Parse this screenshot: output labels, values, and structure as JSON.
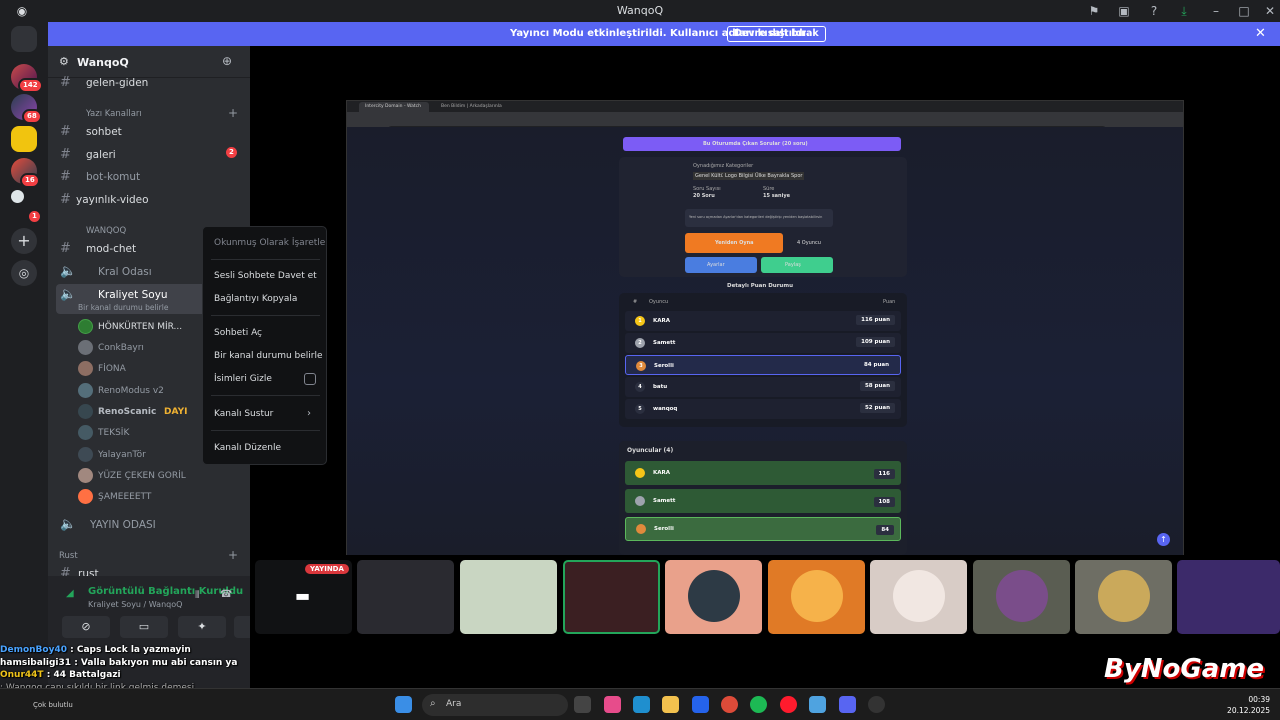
{
  "window": {
    "title": "WanqoQ"
  },
  "banner": {
    "message": "Yayıncı Modu etkinleştirildi. Kullanıcı adları kısaltıldı.",
    "button": "Devre dışı bırak"
  },
  "guilds": {
    "badges": [
      "142",
      "68",
      "16",
      "1"
    ]
  },
  "server": {
    "name": "WanqoQ",
    "channels_top": [
      {
        "label": "gelen-giden"
      }
    ],
    "category_text": "Yazı Kanalları",
    "text_channels": [
      {
        "label": "sohbet"
      },
      {
        "label": "galeri",
        "badge": "2"
      },
      {
        "label": "bot-komut"
      },
      {
        "label": "yayınlık-video"
      }
    ],
    "category_wanqoq": "WANQOQ",
    "wanqoq_channels": [
      {
        "label": "mod-chet"
      },
      {
        "label": "Kral Odası"
      },
      {
        "label": "Kraliyet Soyu",
        "status": "Bir kanal durumu belirle"
      }
    ],
    "members": [
      "HÖNKÜRTEN MİR...",
      "ConkBayrı",
      "FİONA",
      "RenoModus v2",
      "RenoScanic",
      "TEKSİK",
      "YalayanTör",
      "YÜZE ÇEKEN GORİL",
      "ŞAMEEEETT"
    ],
    "member_tag": "DAYI",
    "yayin_odasi": "YAYIN ODASI",
    "category_rust": "Rust",
    "rust_channel": "rust"
  },
  "voice": {
    "status": "Görüntülü Bağlantı Kuruldu",
    "channel": "Kraliyet Soyu / WanqoQ"
  },
  "overlay_chat": [
    {
      "user": "DemonBoy40",
      "text": ": Caps Lock la yazmayin"
    },
    {
      "user": "hamsibaligi31",
      "text": ": Valla bakıyon mu abi cansın ya"
    },
    {
      "user": "Onur44T",
      "text": ": 44 Battalgazi"
    },
    {
      "user": "",
      "text": ": Wanqoq canı sıkıldı bir link gelmiş demesi"
    }
  ],
  "context_menu": [
    {
      "label": "Okunmuş Olarak İşaretle",
      "dim": true
    },
    {
      "label": "Sesli Sohbete Davet et"
    },
    {
      "label": "Bağlantıyı Kopyala"
    },
    {
      "label": "Sohbeti Aç"
    },
    {
      "label": "Bir kanal durumu belirle"
    },
    {
      "label": "İsimleri Gizle"
    },
    {
      "label": "Kanalı Sustur"
    },
    {
      "label": "Kanalı Düzenle"
    }
  ],
  "stream": {
    "tab1": "Intercity Domain - Watch Golf...",
    "tab2": "Ben Bildim | Arkadaşlarınla Ona...",
    "url": "benbildim.com/room/3VP9YM",
    "header": "Bu Oturumda Çıkan Sorular (20 soru)",
    "categories_title": "Oynadığımız Kategoriler",
    "categories": [
      "Genel Kültür",
      "Logo Bilgisi",
      "Ülke Bayrakları",
      "Spor"
    ],
    "question_count_label": "Soru Sayısı",
    "question_count": "20 Soru",
    "time_label": "Süre",
    "time": "15 saniye",
    "note": "Yeni soru açmadan Ayarlar'dan kategorileri değiştirip yeniden başlatabilirsin",
    "replay": "Yeniden Oyna",
    "player_count": "4 Oyuncu",
    "settings": "Ayarlar",
    "share": "Paylaş",
    "details_title": "Detaylı Puan Durumu",
    "col_rank": "#",
    "col_player": "Oyuncu",
    "col_points": "Puan",
    "scores": [
      {
        "rank": "1",
        "name": "KARA",
        "points": "116 puan"
      },
      {
        "rank": "2",
        "name": "Samett",
        "points": "109 puan"
      },
      {
        "rank": "3",
        "name": "Serolli",
        "points": "84 puan"
      },
      {
        "rank": "4",
        "name": "batu",
        "points": "58 puan"
      },
      {
        "rank": "5",
        "name": "wanqoq",
        "points": "52 puan"
      }
    ],
    "players_title": "Oyuncular (4)",
    "players": [
      {
        "name": "KARA",
        "score": "116"
      },
      {
        "name": "Samett",
        "score": "108"
      },
      {
        "name": "Serolli",
        "score": "84"
      }
    ]
  },
  "tiles": {
    "live_label": "YAYINDA"
  },
  "logo": {
    "text": "ByNoGame"
  },
  "taskbar": {
    "weather": "Çok bulutlu",
    "search": "Ara",
    "time": "00:39",
    "date": "20.12.2025"
  }
}
